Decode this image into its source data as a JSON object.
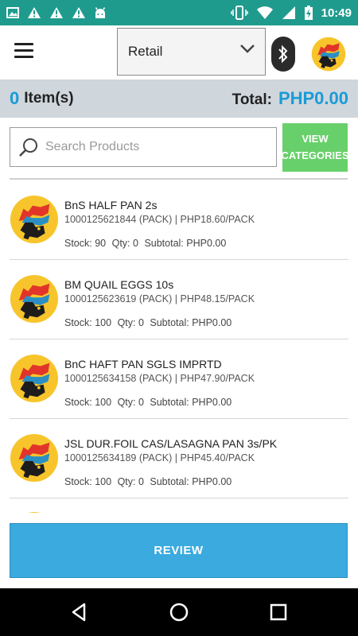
{
  "status_bar": {
    "time": "10:49",
    "left_icons": [
      "image-icon",
      "warning-icon",
      "warning-icon",
      "warning-icon",
      "android-icon"
    ],
    "right_icons": [
      "vibrate-icon",
      "wifi-icon",
      "signal-icon",
      "battery-charging-icon"
    ]
  },
  "header": {
    "menu_icon": "hamburger-menu-icon",
    "store_select": {
      "selected": "Retail"
    },
    "bluetooth_icon": "bluetooth-icon"
  },
  "summary": {
    "item_count": "0",
    "item_label": "Item(s)",
    "total_label": "Total:",
    "total_value": "PHP0.00"
  },
  "search": {
    "placeholder": "Search Products",
    "view_categories_label": "VIEW\nCATEGORIES"
  },
  "products": [
    {
      "name": "BnS HALF PAN 2s",
      "code_price": "1000125621844 (PACK) | PHP18.60/PACK",
      "stock": "Stock: 90",
      "qty": "Qty: 0",
      "subtotal": "Subtotal: PHP0.00"
    },
    {
      "name": "BM QUAIL EGGS 10s",
      "code_price": "1000125623619 (PACK) | PHP48.15/PACK",
      "stock": "Stock: 100",
      "qty": "Qty: 0",
      "subtotal": "Subtotal: PHP0.00"
    },
    {
      "name": "BnC HAFT PAN SGLS IMPRTD",
      "code_price": "1000125634158 (PACK) | PHP47.90/PACK",
      "stock": "Stock: 100",
      "qty": "Qty: 0",
      "subtotal": "Subtotal: PHP0.00"
    },
    {
      "name": "JSL DUR.FOIL CAS/LASAGNA PAN 3s/PK",
      "code_price": "1000125634189 (PACK) | PHP45.40/PACK",
      "stock": "Stock: 100",
      "qty": "Qty: 0",
      "subtotal": "Subtotal: PHP0.00"
    }
  ],
  "review_button": {
    "label": "REVIEW"
  },
  "colors": {
    "status_bar": "#1f9b8e",
    "accent_blue": "#1a9bd7",
    "view_categories_green": "#68d06a",
    "review_blue": "#3aaadf",
    "summary_bg": "#cfd6dc"
  },
  "nav_bar": {
    "icons": [
      "back-icon",
      "home-icon",
      "recents-icon"
    ]
  }
}
